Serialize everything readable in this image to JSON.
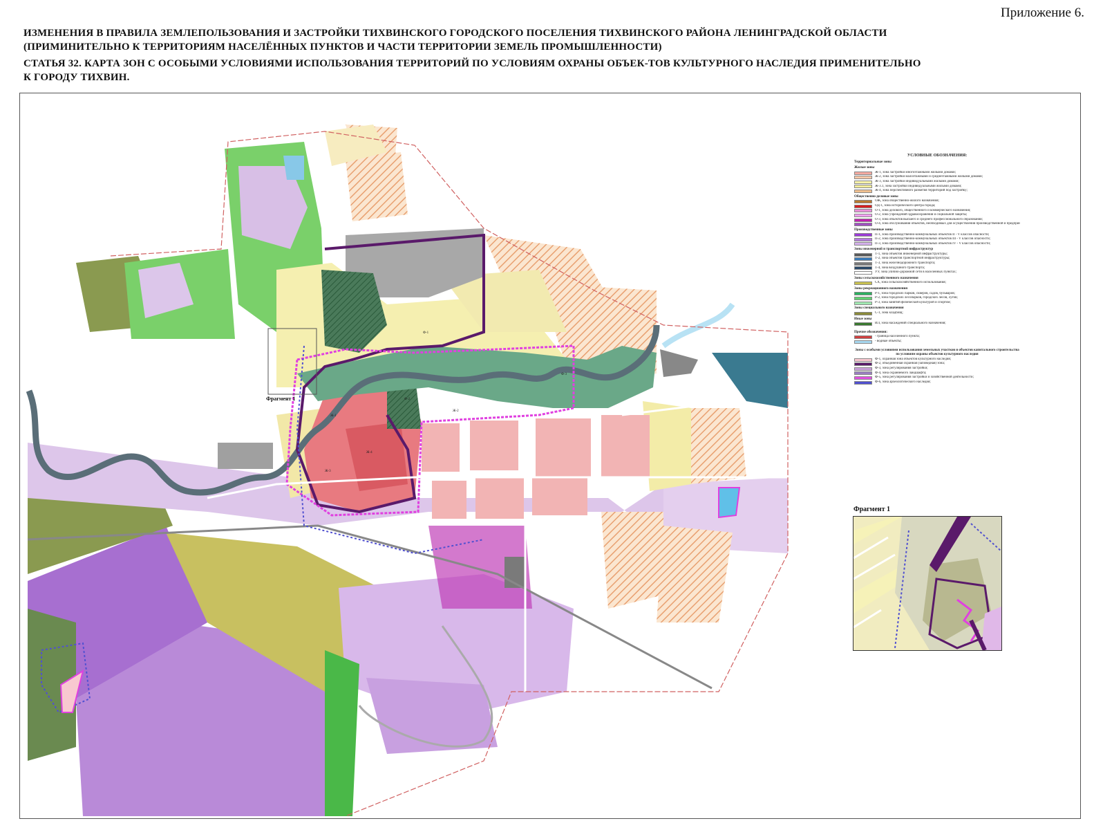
{
  "header": {
    "appendix": "Приложение 6.",
    "title_line1": "ИЗМЕНЕНИЯ В ПРАВИЛА ЗЕМЛЕПОЛЬЗОВАНИЯ И ЗАСТРОЙКИ ТИХВИНСКОГО ГОРОДСКОГО ПОСЕЛЕНИЯ ТИХВИНСКОГО РАЙОНА ЛЕНИНГРАДСКОЙ ОБЛАСТИ",
    "title_line2": "(ПРИМИНИТЕЛЬНО К ТЕРРИТОРИЯМ НАСЕЛЁННЫХ ПУНКТОВ И ЧАСТИ ТЕРРИТОРИИ ЗЕМЕЛЬ ПРОМЫШЛЕННОСТИ)",
    "title_line3": "СТАТЬЯ 32. КАРТА ЗОН С ОСОБЫМИ УСЛОВИЯМИ ИСПОЛЬЗОВАНИЯ ТЕРРИТОРИЙ ПО УСЛОВИЯМ ОХРАНЫ ОБЪЕК-ТОВ КУЛЬТУРНОГО НАСЛЕДИЯ ПРИМЕНИТЕЛЬНО",
    "title_line4": "К ГОРОДУ ТИХВИН."
  },
  "legend": {
    "title": "УСЛОВНЫЕ ОБОЗНАЧЕНИЯ:",
    "section_territorial": "Территориальные зоны",
    "section_residential": "Жилые зоны",
    "residential": [
      {
        "label": "Ж-1, зона застройки многоэтажными жилыми домами;",
        "color": "#f4a9a0"
      },
      {
        "label": "Ж-2, зона застройки малоэтажными и среднеэтажными жилыми домами;",
        "color": "#f9c8a8"
      },
      {
        "label": "Ж-3, зона застройки индивидуальными жилыми домами;",
        "color": "#f7f2a8"
      },
      {
        "label": "Ж-3.1, зона застройки индивидуальными жилыми домами;",
        "color": "#f3ec9a"
      },
      {
        "label": "Ж-4, зона перспективного развития территорий под застройку;",
        "color": "#f0c090"
      }
    ],
    "section_public": "Общественно-деловые зоны",
    "public": [
      {
        "label": "ОЖ, зона общественно-жилого назначения;",
        "color": "#b87a30"
      },
      {
        "label": "ОД-1, зона исторического центра города;",
        "color": "#d81e1e"
      },
      {
        "label": "О-1, зона делового, общественного и коммерческого назначения;",
        "color": "#e890d8"
      },
      {
        "label": "О-2, зона учреждений здравоохранения и социальной защиты;",
        "color": "#f0a0f0"
      },
      {
        "label": "О-3, зона объектов высшего и среднего профессионального образования;",
        "color": "#c020b0"
      },
      {
        "label": "О-4, зона обслуживания объектов, необходимых для осуществления производственной и предпринимательской деятельности;",
        "color": "#a050c0"
      }
    ],
    "section_industrial": "Производственные зоны",
    "industrial": [
      {
        "label": "П-1, зона производственно-коммунальных объектов II - V классов опасности;",
        "color": "#9b3ad8"
      },
      {
        "label": "П-2, зона производственно-коммунальных объектов III - V классов опасности;",
        "color": "#b57ae0"
      },
      {
        "label": "П-3, зона производственно-коммунальных объектов IV - V классов опасности;",
        "color": "#d4b0ec"
      }
    ],
    "section_engineering": "Зоны инженерной и транспортной инфраструктур",
    "engineering": [
      {
        "label": "Т-1, зона объектов инженерной инфраструктуры;",
        "color": "#5a5a5a"
      },
      {
        "label": "Т-2, зона объектов транспортной инфраструктуры;",
        "color": "#3a7ab8"
      },
      {
        "label": "Т-3, зона железнодорожного транспорта;",
        "color": "#7a7a7a"
      },
      {
        "label": "Т-4, зона воздушного транспорта;",
        "color": "#2a4a6a"
      },
      {
        "label": "УУ, зона улично-дорожной сети в населенных пунктах;",
        "color": "#ffffff"
      }
    ],
    "section_agri": "Зоны сельскохозяйственного назначения",
    "agri": [
      {
        "label": "СХ, зона сельскохозяйственного использования;",
        "color": "#c8c050"
      }
    ],
    "section_recreation": "Зоны рекреационного назначения",
    "recreation": [
      {
        "label": "Р-1, зона городских парков, скверов, садов, бульваров;",
        "color": "#2cb060"
      },
      {
        "label": "Р-2, зона городских лесопарков, городских лесов, лугов;",
        "color": "#60d070"
      },
      {
        "label": "Р-3, зона занятий физической культурой и спортом;",
        "color": "#a0e8b0"
      }
    ],
    "section_special": "Зоны специального назначения",
    "special": [
      {
        "label": "С-1, зона кладбищ;",
        "color": "#8a8a3a"
      }
    ],
    "section_other": "Иные зоны",
    "other": [
      {
        "label": "ИЛ, зона насаждений специального назначения;",
        "color": "#3a7a30"
      }
    ],
    "section_misc": "Прочие обозначения:",
    "misc": [
      {
        "label": "- граница населенного пункта;",
        "color": "#d04040"
      },
      {
        "label": "- водные объекты;",
        "color": "#a8d8f0"
      }
    ],
    "section_zones": "Зоны с особыми условиями использования земельных участков и объектов капитального строительства по условиям охраны объектов культурного наследия",
    "zones": [
      {
        "label": "Ф-1, охранная зона объектов культурного наследия;",
        "color": "#f8c8d0"
      },
      {
        "label": "Ф-2, объединенная охранная (заповедная) зона;",
        "color": "#5a1a6a"
      },
      {
        "label": "Ф-3, зона регулирования застройки;",
        "color": "#c8a0d8"
      },
      {
        "label": "Ф-4, зона охраняемого ландшафта;",
        "color": "#9a80c0"
      },
      {
        "label": "Ф-5, зона регулирования застройки и хозяйственной деятельности;",
        "color": "#e050e0"
      },
      {
        "label": "Ф-6, зона археологического наследия;",
        "color": "#5050d0"
      }
    ]
  },
  "map": {
    "fragment_label": "Фрагмент 1",
    "inset_label": "Фрагмент 1",
    "zone_labels": [
      "Ж-1",
      "Ж-2",
      "Ж-3",
      "Ж-4",
      "Ф-1",
      "Ф-2",
      "Ф-3"
    ]
  }
}
